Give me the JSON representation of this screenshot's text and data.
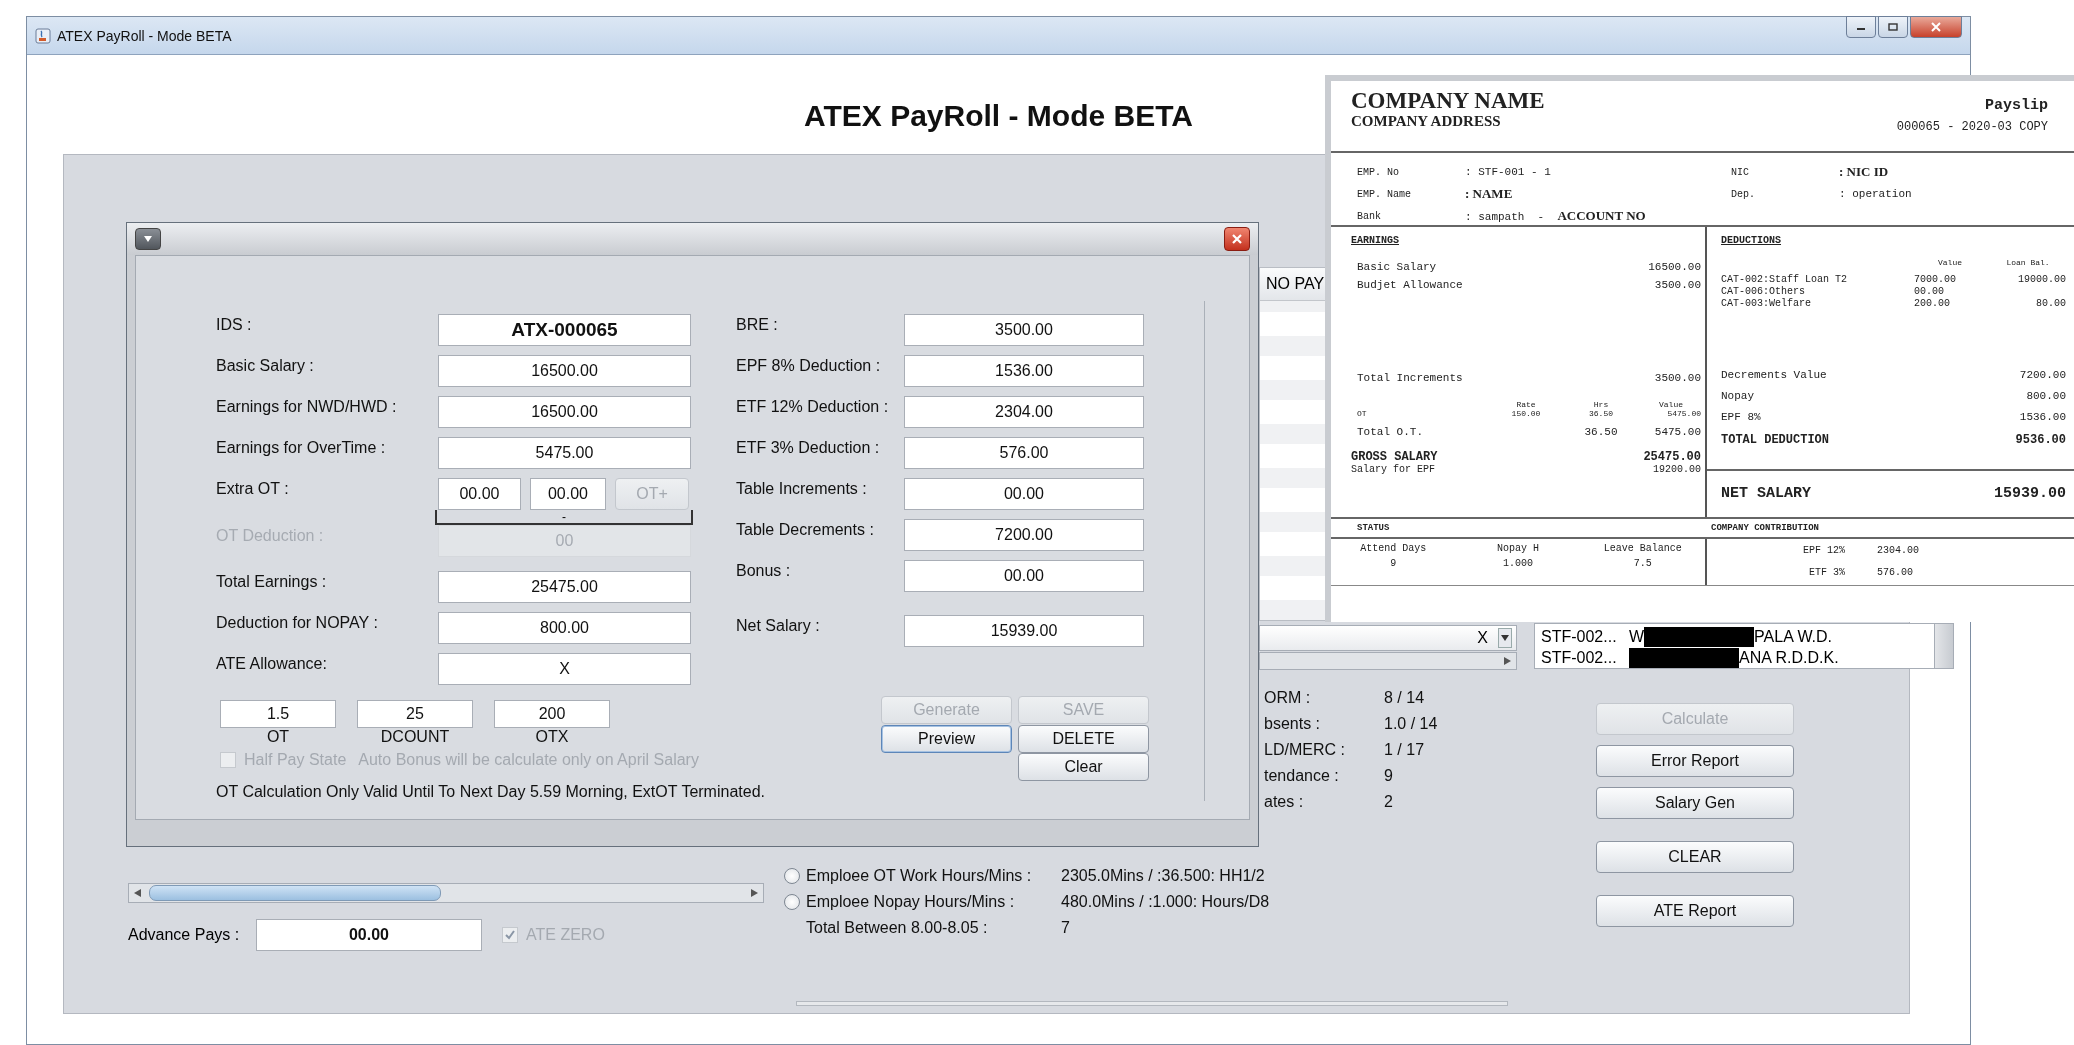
{
  "window": {
    "title": "ATEX PayRoll - Mode BETA",
    "heading": "ATEX PayRoll - Mode BETA"
  },
  "main": {
    "table_header": "NO PAY",
    "combo": {
      "value": "X"
    },
    "employee_list": [
      {
        "id": "STF-002...",
        "name_start": "W",
        "name_end": "PALA W.D."
      },
      {
        "id": "STF-002...",
        "name_end": "ANA R.D.D.K."
      }
    ],
    "stats": [
      {
        "label": "ORM :",
        "value": "8 / 14"
      },
      {
        "label": "bsents :",
        "value": "1.0 / 14"
      },
      {
        "label": "LD/MERC :",
        "value": "1 / 17"
      },
      {
        "label": "tendance :",
        "value": "9"
      },
      {
        "label": "ates :",
        "value": "2"
      }
    ],
    "hours": [
      {
        "kind": "radio",
        "selected": false,
        "label": "Emploee OT Work Hours/Mins :",
        "value": "2305.0Mins / :36.500: HH1/2"
      },
      {
        "kind": "radio",
        "selected": false,
        "label": "Emploee Nopay Hours/Mins :",
        "value": "480.0Mins / :1.000: Hours/D8"
      },
      {
        "kind": "plain",
        "label": "Total Between 8.00-8.05 :",
        "value": "7"
      }
    ],
    "buttons": [
      {
        "label": "Calculate",
        "disabled": true
      },
      {
        "label": "Error Report",
        "disabled": false
      },
      {
        "label": "Salary Gen",
        "disabled": false
      },
      {
        "label": "CLEAR",
        "disabled": false
      },
      {
        "label": "ATE Report",
        "disabled": false
      }
    ],
    "advance_pays": {
      "label": "Advance Pays :",
      "value": "00.00"
    },
    "ate_zero": {
      "label": "ATE ZERO",
      "checked": true,
      "disabled": true
    }
  },
  "dialog": {
    "left_fields": [
      {
        "kind": "id",
        "label": "IDS :",
        "value": "ATX-000065",
        "disabled": false
      },
      {
        "kind": "text",
        "label": "Basic Salary :",
        "value": "16500.00",
        "disabled": false
      },
      {
        "kind": "text",
        "label": "Earnings for NWD/HWD :",
        "value": "16500.00",
        "disabled": false
      },
      {
        "kind": "text",
        "label": "Earnings for OverTime :",
        "value": "5475.00",
        "disabled": false
      },
      {
        "kind": "extra_ot",
        "label": "Extra OT :",
        "values": [
          "00.00",
          "00.00"
        ],
        "button": {
          "label": "OT+",
          "disabled": true
        },
        "range": "-",
        "disabled": false
      },
      {
        "kind": "text",
        "label": "OT Deduction :",
        "value": "00",
        "disabled": true
      },
      {
        "kind": "text",
        "label": "Total Earnings :",
        "value": "25475.00",
        "disabled": false
      },
      {
        "kind": "text",
        "label": "Deduction for NOPAY :",
        "value": "800.00",
        "disabled": false
      },
      {
        "kind": "text",
        "label": "ATE Allowance:",
        "value": "X",
        "disabled": false
      }
    ],
    "right_fields": [
      {
        "label": "BRE :",
        "value": "3500.00"
      },
      {
        "label": "EPF 8% Deduction :",
        "value": "1536.00"
      },
      {
        "label": "ETF 12% Deduction :",
        "value": "2304.00"
      },
      {
        "label": "ETF 3% Deduction :",
        "value": "576.00"
      },
      {
        "label": "Table Increments :",
        "value": "00.00"
      },
      {
        "label": "Table Decrements :",
        "value": "7200.00"
      },
      {
        "label": "Bonus :",
        "value": "00.00"
      },
      {
        "label": "Net Salary :",
        "value": "15939.00"
      }
    ],
    "factors": [
      {
        "value": "1.5",
        "caption": "OT"
      },
      {
        "value": "25",
        "caption": "DCOUNT"
      },
      {
        "value": "200",
        "caption": "OTX"
      }
    ],
    "half_pay": {
      "label": "Half Pay State",
      "checked": false,
      "disabled": true
    },
    "bonus_note": {
      "text": "Auto Bonus will be calculate only on April Salary",
      "disabled": true
    },
    "footer": "OT Calculation Only Valid Until To Next Day 5.59 Morning, ExtOT Terminated.",
    "buttons": [
      {
        "label": "Generate",
        "disabled": true,
        "focused": false
      },
      {
        "label": "SAVE",
        "disabled": true,
        "focused": false
      },
      {
        "label": "Preview",
        "disabled": false,
        "focused": true
      },
      {
        "label": "DELETE",
        "disabled": false,
        "focused": false
      },
      {
        "label": "Clear",
        "disabled": false,
        "focused": false
      }
    ]
  },
  "payslip": {
    "company_name": "COMPANY NAME",
    "company_address": "COMPANY ADDRESS",
    "title": "Payslip",
    "reference": "000065 - 2020-03 COPY",
    "info": [
      {
        "label": "EMP. No",
        "value": ": STF-001 - 1",
        "bold": false
      },
      {
        "label": "NIC",
        "value": ": NIC ID",
        "bold": true
      },
      {
        "label": "EMP. Name",
        "value": ": NAME",
        "bold": true
      },
      {
        "label": "Dep.",
        "value": ": operation",
        "bold": false
      },
      {
        "label": "Bank",
        "value": ": sampath  -  **ACCOUNT NO**",
        "bold": false
      }
    ],
    "earnings_heading": "EARNINGS",
    "earnings": [
      {
        "label": "Basic Salary",
        "value": "16500.00"
      },
      {
        "label": "Budjet Allowance",
        "value": "3500.00"
      }
    ],
    "total_increments": {
      "label": "Total Increments",
      "value": "3500.00"
    },
    "ot_columns": [
      "Rate",
      "Hrs",
      "Value"
    ],
    "ot_rows": [
      {
        "label": "OT",
        "rate": "150.00",
        "hours": "36.50",
        "value": "5475.00"
      }
    ],
    "total_ot": {
      "label": "Total O.T.",
      "hours": "36.50",
      "value": "5475.00"
    },
    "gross_salary": {
      "label": "GROSS SALARY",
      "value": "25475.00"
    },
    "salary_for_epf": {
      "label": "Salary for EPF",
      "value": "19200.00"
    },
    "deductions_heading": "DEDUCTIONS",
    "deduction_columns": [
      "Value",
      "Loan Bal."
    ],
    "deductions": [
      {
        "label": "CAT-002:Staff Loan T2",
        "value": "7000.00",
        "balance": "19000.00"
      },
      {
        "label": "CAT-006:Others",
        "value": "00.00"
      },
      {
        "label": "CAT-003:Welfare",
        "value": "200.00",
        "balance": "80.00"
      }
    ],
    "deduction_totals": [
      {
        "label": "Decrements Value",
        "value": "7200.00"
      },
      {
        "label": "Nopay",
        "value": "800.00"
      },
      {
        "label": "EPF 8%",
        "value": "1536.00"
      }
    ],
    "total_deduction": {
      "label": "TOTAL DEDUCTION",
      "value": "9536.00"
    },
    "net_salary": {
      "label": "NET SALARY",
      "value": "15939.00"
    },
    "status_heading": "STATUS",
    "status": [
      {
        "label": "Attend Days",
        "value": "9"
      },
      {
        "label": "Nopay H",
        "value": "1.000"
      },
      {
        "label": "Leave Balance",
        "value": "7.5"
      }
    ],
    "contribution_heading": "COMPANY CONTRIBUTION",
    "contributions": [
      {
        "label": "EPF 12%",
        "value": "2304.00"
      },
      {
        "label": "ETF 3%",
        "value": "576.00"
      }
    ]
  }
}
